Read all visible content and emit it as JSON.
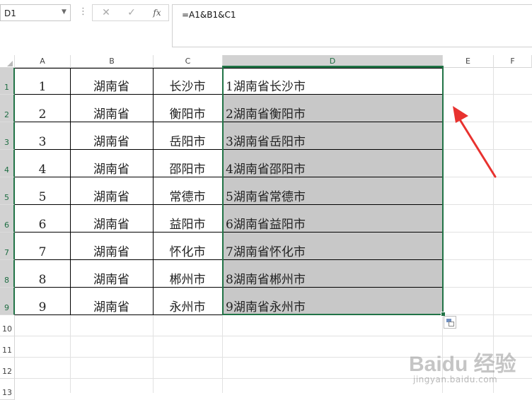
{
  "formula_bar": {
    "name_box": "D1",
    "cancel_icon": "✕",
    "enter_icon": "✓",
    "fx_label": "fx",
    "formula": "=A1&B1&C1"
  },
  "columns": [
    "A",
    "B",
    "C",
    "D",
    "E",
    "F"
  ],
  "selected_column": "D",
  "rows": [
    "1",
    "2",
    "3",
    "4",
    "5",
    "6",
    "7",
    "8",
    "9",
    "10",
    "11",
    "12",
    "13"
  ],
  "table": [
    {
      "a": "1",
      "b": "湖南省",
      "c": "长沙市",
      "d": "1湖南省长沙市"
    },
    {
      "a": "2",
      "b": "湖南省",
      "c": "衡阳市",
      "d": "2湖南省衡阳市"
    },
    {
      "a": "3",
      "b": "湖南省",
      "c": "岳阳市",
      "d": "3湖南省岳阳市"
    },
    {
      "a": "4",
      "b": "湖南省",
      "c": "邵阳市",
      "d": "4湖南省邵阳市"
    },
    {
      "a": "5",
      "b": "湖南省",
      "c": "常德市",
      "d": "5湖南省常德市"
    },
    {
      "a": "6",
      "b": "湖南省",
      "c": "益阳市",
      "d": "6湖南省益阳市"
    },
    {
      "a": "7",
      "b": "湖南省",
      "c": "怀化市",
      "d": "7湖南省怀化市"
    },
    {
      "a": "8",
      "b": "湖南省",
      "c": "郴州市",
      "d": "8湖南省郴州市"
    },
    {
      "a": "9",
      "b": "湖南省",
      "c": "永州市",
      "d": "9湖南省永州市"
    }
  ],
  "watermark": {
    "main": "Baidu 经验",
    "sub": "jingyan.baidu.com"
  },
  "colors": {
    "selection": "#217346",
    "fill": "#c8c8c8",
    "arrow": "#e8322f"
  }
}
